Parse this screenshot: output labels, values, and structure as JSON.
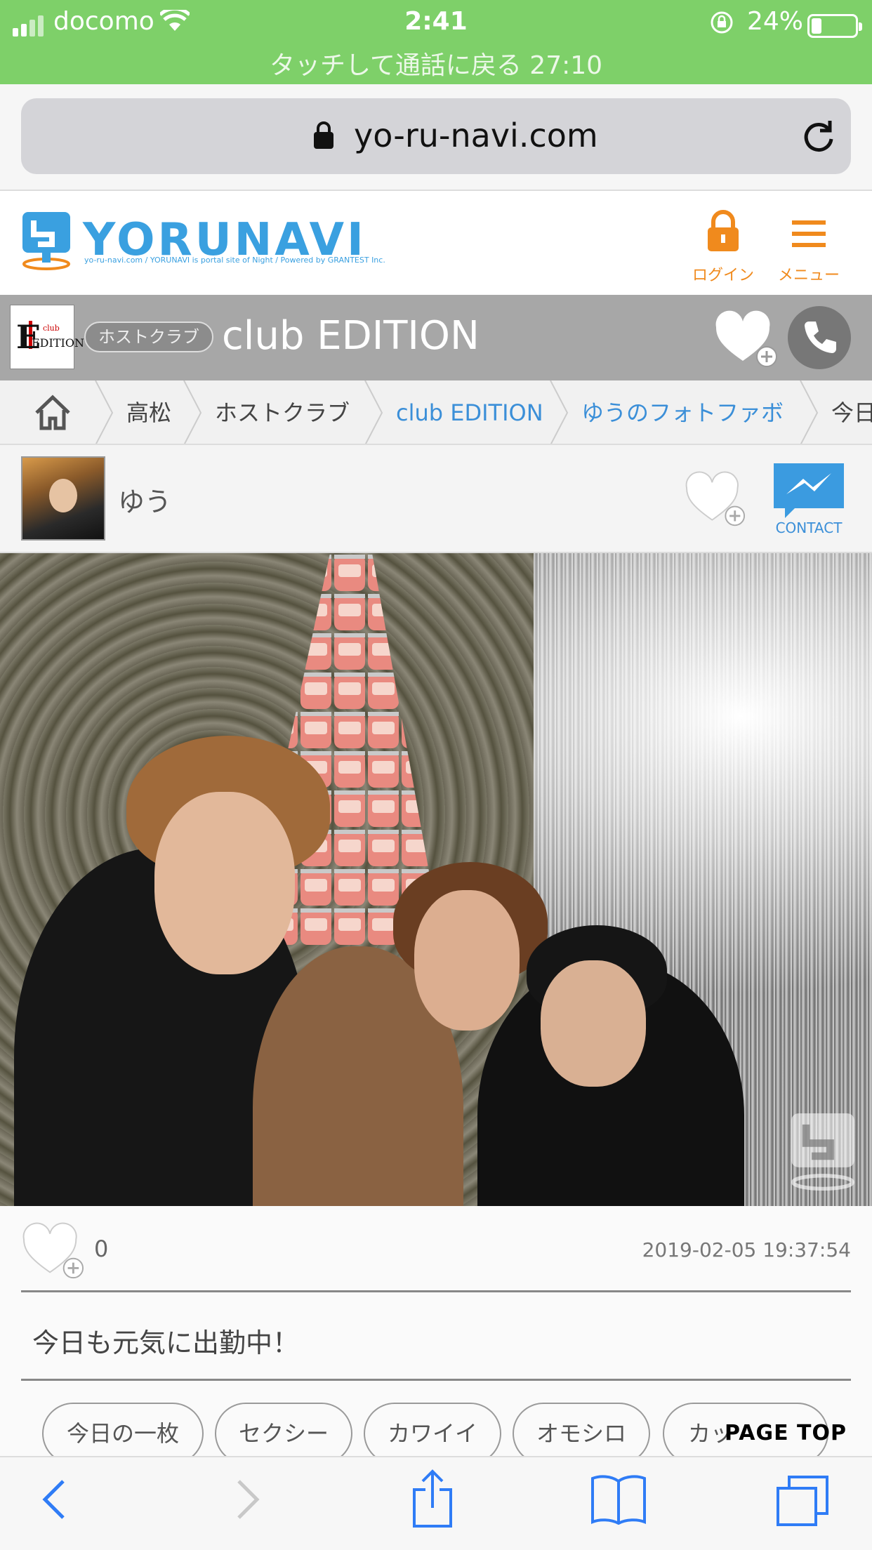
{
  "status_bar": {
    "carrier": "docomo",
    "time": "2:41",
    "battery_percent": "24%",
    "battery_level": 0.24,
    "call_banner": "タッチして通話に戻る 27:10"
  },
  "browser": {
    "url": "yo-ru-navi.com"
  },
  "site_header": {
    "logo_text": "YORUNAVI",
    "logo_tagline": "yo-ru-navi.com / YORUNAVI is portal site of Night / Powered by GRANTEST Inc.",
    "login_label": "ログイン",
    "menu_label": "メニュー",
    "accent_color": "#f08a1d"
  },
  "shop": {
    "logo_text": "EDITION",
    "logo_club": "club",
    "category_tag": "ホストクラブ",
    "name": "club EDITION"
  },
  "breadcrumb": {
    "items": [
      {
        "label": "高松"
      },
      {
        "label": "ホストクラブ"
      },
      {
        "label": "club EDITION"
      },
      {
        "label": "ゆうのフォトファボ"
      },
      {
        "label": "今日"
      }
    ]
  },
  "profile": {
    "name": "ゆう",
    "contact_label": "CONTACT"
  },
  "post": {
    "likes": "0",
    "timestamp": "2019-02-05 19:37:54",
    "caption": "今日も元気に出勤中！"
  },
  "tags": [
    {
      "label": "今日の一枚"
    },
    {
      "label": "セクシー"
    },
    {
      "label": "カワイイ"
    },
    {
      "label": "オモシロ"
    },
    {
      "label": "カッ"
    }
  ],
  "page_top_label": "PAGE TOP",
  "colors": {
    "status_green": "#7ed069",
    "link_blue": "#3b8fd8",
    "shop_bar_gray": "#a7a7a7"
  }
}
